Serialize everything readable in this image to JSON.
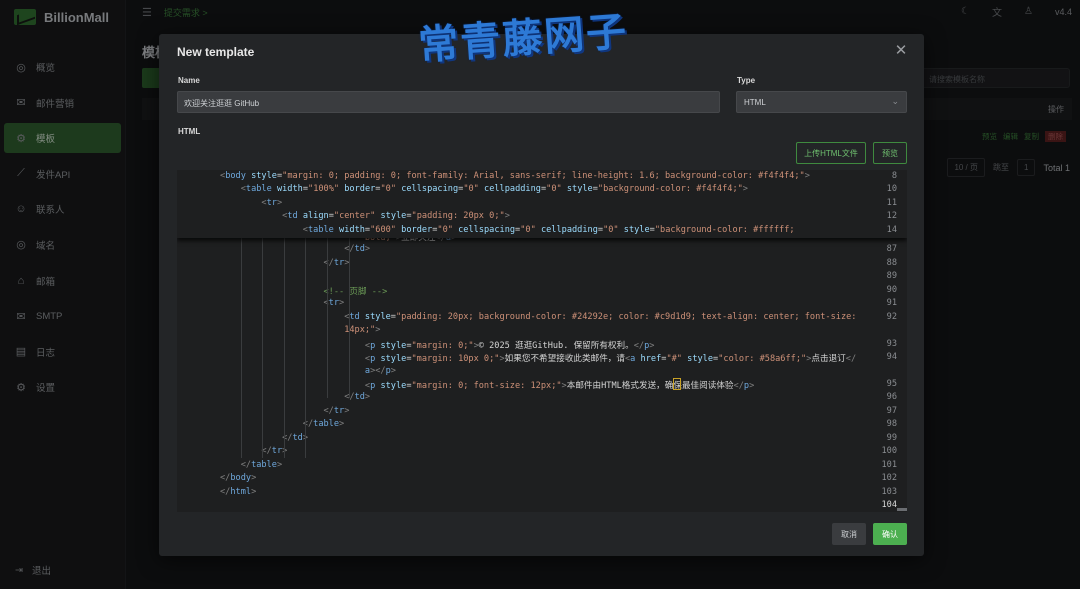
{
  "app": {
    "brand": "BillionMall",
    "topbar_link": "提交需求 >",
    "version": "v4.4",
    "page_title": "模板",
    "search_placeholder": "请搜索模板名称",
    "table_op_header": "操作",
    "row_actions": [
      "预览",
      "编辑",
      "复制",
      "删除"
    ],
    "pager": {
      "page_size": "10 / 页",
      "goto_label": "跳至",
      "goto_value": "1",
      "total": "Total 1"
    },
    "nav_items": [
      {
        "label": "概览",
        "icon": "globe-icon"
      },
      {
        "label": "邮件营销",
        "icon": "mail-marketing-icon"
      },
      {
        "label": "模板",
        "icon": "gear-icon",
        "active": true
      },
      {
        "label": "发件API",
        "icon": "chart-icon"
      },
      {
        "label": "联系人",
        "icon": "contacts-icon"
      },
      {
        "label": "域名",
        "icon": "domain-icon"
      },
      {
        "label": "邮箱",
        "icon": "mailbox-icon"
      },
      {
        "label": "SMTP",
        "icon": "smtp-icon"
      },
      {
        "label": "日志",
        "icon": "log-icon"
      },
      {
        "label": "设置",
        "icon": "settings-icon"
      }
    ],
    "logout": "退出"
  },
  "modal": {
    "title": "New template",
    "name_label": "Name",
    "name_value": "欢迎关注逛逛 GitHub",
    "type_label": "Type",
    "type_value": "HTML",
    "html_label": "HTML",
    "upload_button": "上传HTML文件",
    "preview_button": "预览",
    "cancel_button": "取消",
    "confirm_button": "确认"
  },
  "editor": {
    "sticky_lines": [
      {
        "n": "8",
        "html": "<span class=\"p\">&lt;</span><span class=\"t\">body</span> <span class=\"a\">style</span>=<span class=\"s\">\"margin: 0; padding: 0; font-family: Arial, sans-serif; line-height: 1.6; background-color: #f4f4f4;\"</span><span class=\"p\">&gt;</span>"
      },
      {
        "n": "10",
        "html": "    <span class=\"p\">&lt;</span><span class=\"t\">table</span> <span class=\"a\">width</span>=<span class=\"s\">\"100%\"</span> <span class=\"a\">border</span>=<span class=\"s\">\"0\"</span> <span class=\"a\">cellspacing</span>=<span class=\"s\">\"0\"</span> <span class=\"a\">cellpadding</span>=<span class=\"s\">\"0\"</span> <span class=\"a\">style</span>=<span class=\"s\">\"background-color: #f4f4f4;\"</span><span class=\"p\">&gt;</span>"
      },
      {
        "n": "11",
        "html": "        <span class=\"p\">&lt;</span><span class=\"t\">tr</span><span class=\"p\">&gt;</span>"
      },
      {
        "n": "12",
        "html": "            <span class=\"p\">&lt;</span><span class=\"t\">td</span> <span class=\"a\">align</span>=<span class=\"s\">\"center\"</span> <span class=\"a\">style</span>=<span class=\"s\">\"padding: 20px 0;\"</span><span class=\"p\">&gt;</span>"
      },
      {
        "n": "14",
        "html": "                <span class=\"p\">&lt;</span><span class=\"t\">table</span> <span class=\"a\">width</span>=<span class=\"s\">\"600\"</span> <span class=\"a\">border</span>=<span class=\"s\">\"0\"</span> <span class=\"a\">cellspacing</span>=<span class=\"s\">\"0\"</span> <span class=\"a\">cellpadding</span>=<span class=\"s\">\"0\"</span> <span class=\"a\">style</span>=<span class=\"s\">\"background-color: #ffffff;</span>"
      }
    ],
    "lines": [
      {
        "n": "",
        "html": "                            <span class=\"s\">bold;\"</span><span class=\"p\">&gt;</span>立即关注<span class=\"p\">&lt;/</span><span class=\"t\">a</span><span class=\"p\">&gt;</span>"
      },
      {
        "n": "87",
        "html": "                        <span class=\"p\">&lt;/</span><span class=\"t\">td</span><span class=\"p\">&gt;</span>"
      },
      {
        "n": "88",
        "html": "                    <span class=\"p\">&lt;/</span><span class=\"t\">tr</span><span class=\"p\">&gt;</span>"
      },
      {
        "n": "89",
        "html": ""
      },
      {
        "n": "90",
        "html": "                    <span class=\"c\">&lt;!-- 页脚 --&gt;</span>"
      },
      {
        "n": "91",
        "html": "                    <span class=\"p\">&lt;</span><span class=\"t\">tr</span><span class=\"p\">&gt;</span>"
      },
      {
        "n": "92",
        "html": "                        <span class=\"p\">&lt;</span><span class=\"t\">td</span> <span class=\"a\">style</span>=<span class=\"s\">\"padding: 20px; background-color: #24292e; color: #c9d1d9; text-align: center; font-size:</span>"
      },
      {
        "n": "",
        "html": "                        <span class=\"s\">14px;\"</span><span class=\"p\">&gt;</span>"
      },
      {
        "n": "93",
        "html": "                            <span class=\"p\">&lt;</span><span class=\"t\">p</span> <span class=\"a\">style</span>=<span class=\"s\">\"margin: 0;\"</span><span class=\"p\">&gt;</span>© 2025 逛逛GitHub. 保留所有权利。<span class=\"p\">&lt;/</span><span class=\"t\">p</span><span class=\"p\">&gt;</span>"
      },
      {
        "n": "94",
        "html": "                            <span class=\"p\">&lt;</span><span class=\"t\">p</span> <span class=\"a\">style</span>=<span class=\"s\">\"margin: 10px 0;\"</span><span class=\"p\">&gt;</span>如果您不希望接收此类邮件，请<span class=\"p\">&lt;</span><span class=\"t\">a</span> <span class=\"a\">href</span>=<span class=\"s\">\"#\"</span> <span class=\"a\">style</span>=<span class=\"s\">\"color: #58a6ff;\"</span><span class=\"p\">&gt;</span>点击退订<span class=\"p\">&lt;/</span>"
      },
      {
        "n": "",
        "html": "                            <span class=\"t\">a</span><span class=\"p\">&gt;&lt;/</span><span class=\"t\">p</span><span class=\"p\">&gt;</span>"
      },
      {
        "n": "95",
        "html": "                            <span class=\"p\">&lt;</span><span class=\"t\">p</span> <span class=\"a\">style</span>=<span class=\"s\">\"margin: 0; font-size: 12px;\"</span><span class=\"p\">&gt;</span>本邮件由HTML格式发送，确保最佳阅读体验<span class=\"p\">&lt;/</span><span class=\"t\">p</span><span class=\"p\">&gt;</span>"
      },
      {
        "n": "96",
        "html": "                        <span class=\"p\">&lt;/</span><span class=\"t\">td</span><span class=\"p\">&gt;</span>"
      },
      {
        "n": "97",
        "html": "                    <span class=\"p\">&lt;/</span><span class=\"t\">tr</span><span class=\"p\">&gt;</span>"
      },
      {
        "n": "98",
        "html": "                <span class=\"p\">&lt;/</span><span class=\"t\">table</span><span class=\"p\">&gt;</span>"
      },
      {
        "n": "99",
        "html": "            <span class=\"p\">&lt;/</span><span class=\"t\">td</span><span class=\"p\">&gt;</span>"
      },
      {
        "n": "100",
        "html": "        <span class=\"p\">&lt;/</span><span class=\"t\">tr</span><span class=\"p\">&gt;</span>"
      },
      {
        "n": "101",
        "html": "    <span class=\"p\">&lt;/</span><span class=\"t\">table</span><span class=\"p\">&gt;</span>"
      },
      {
        "n": "102",
        "html": "<span class=\"p\">&lt;/</span><span class=\"t\">body</span><span class=\"p\">&gt;</span>"
      },
      {
        "n": "103",
        "html": "<span class=\"p\">&lt;/</span><span class=\"t\">html</span><span class=\"p\">&gt;</span>"
      },
      {
        "n": "104",
        "html": "",
        "current": true
      }
    ]
  },
  "watermark": "常青藤网子"
}
